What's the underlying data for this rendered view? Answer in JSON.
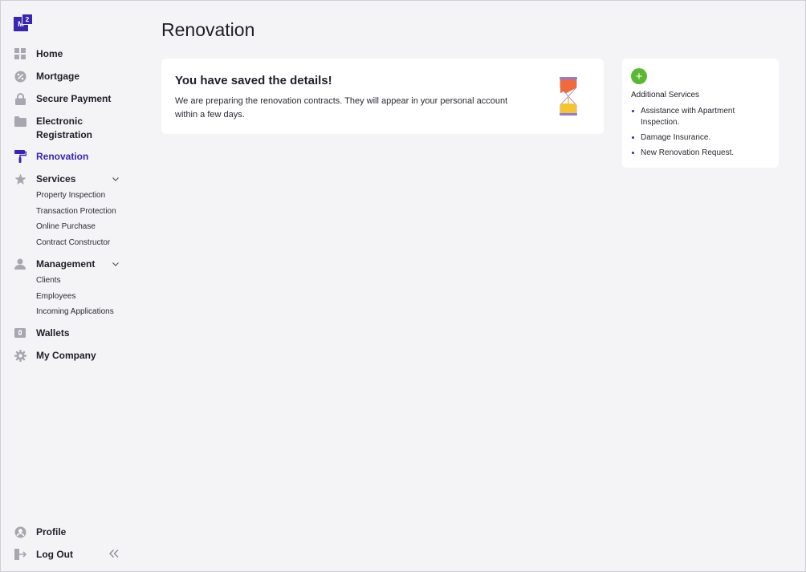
{
  "logo": {
    "main": "M",
    "sup": "2"
  },
  "nav": {
    "home": "Home",
    "mortgage": "Mortgage",
    "secure_payment": "Secure Payment",
    "electronic_registration_1": "Electronic",
    "electronic_registration_2": "Registration",
    "renovation": "Renovation",
    "services": "Services",
    "services_sub": [
      "Property Inspection",
      "Transaction Protection",
      "Online Purchase",
      "Contract Constructor"
    ],
    "management": "Management",
    "management_sub": [
      "Clients",
      "Employees",
      "Incoming Applications"
    ],
    "wallets": "Wallets",
    "my_company": "My Company",
    "profile": "Profile",
    "log_out": "Log Out"
  },
  "page": {
    "title": "Renovation"
  },
  "notice": {
    "heading": "You have saved the details!",
    "text": "We are preparing the renovation contracts. They will appear in your personal account within a few days."
  },
  "additional": {
    "plus": "+",
    "title": "Additional Services",
    "items": [
      "Assistance with Apartment Inspection.",
      "Damage Insurance.",
      "New Renovation Request."
    ]
  },
  "colors": {
    "accent": "#3a24b3",
    "icon_gray": "#a8a6b0",
    "green": "#5bb832",
    "hourglass_orange": "#f06a3c",
    "hourglass_yellow": "#f5c431",
    "hourglass_purple": "#8d7bde"
  }
}
